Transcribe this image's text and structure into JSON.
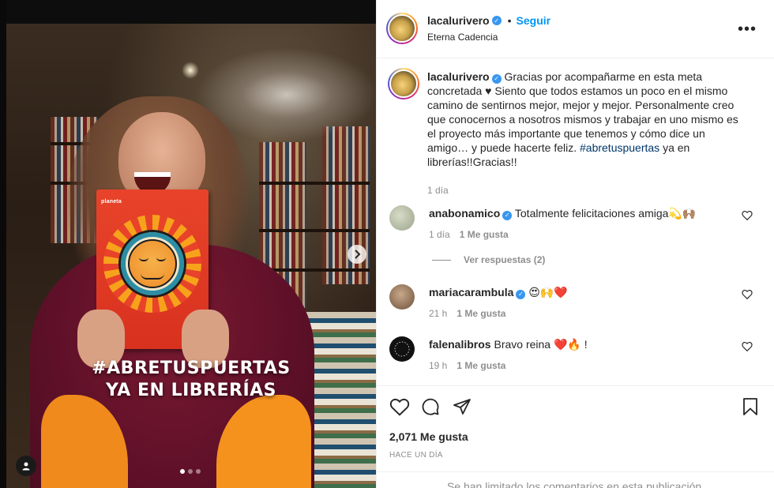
{
  "post": {
    "username": "lacalurivero",
    "follow_label": "Seguir",
    "separator": "•",
    "location": "Eterna Cadencia",
    "more_label": "•••"
  },
  "media": {
    "book_brand": "planeta",
    "overlay_line1": "#ABRETUSPUERTAS",
    "overlay_line2": "YA EN LIBRERÍAS",
    "slide_count": 3,
    "active_slide": 1
  },
  "caption": {
    "username": "lacalurivero",
    "text_before": "Gracias por acompañarme en esta meta concretada ♥ Siento que todos estamos un poco en el mismo camino de sentirnos mejor, mejor y mejor. Personalmente creo que conocernos a nosotros mismos y trabajar en uno mismo es el proyecto más importante que tenemos y cómo dice un amigo… y puede hacerte feliz. ",
    "hashtag": "#abretuspuertas",
    "text_after": " ya en librerías!!Gracias!!",
    "time": "1 día"
  },
  "comments": [
    {
      "username": "anabonamico",
      "verified": true,
      "text": "Totalmente felicitaciones amiga💫🙌🏽",
      "time": "1 día",
      "likes": "1 Me gusta"
    },
    {
      "username": "mariacarambula",
      "verified": true,
      "text": "😍🙌❤️",
      "time": "21 h",
      "likes": "1 Me gusta"
    },
    {
      "username": "falenalibros",
      "verified": false,
      "text": "Bravo reina ❤️🔥 !",
      "time": "19 h",
      "likes": "1 Me gusta"
    }
  ],
  "replies_label": "Ver respuestas (2)",
  "footer": {
    "likes": "2,071 Me gusta",
    "ago": "HACE UN DÍA",
    "limited": "Se han limitado los comentarios en esta publicación."
  },
  "colors": {
    "accent": "#0095f6",
    "verified": "#3897f0",
    "hashtag": "#00376b",
    "muted": "#8e8e8e"
  }
}
